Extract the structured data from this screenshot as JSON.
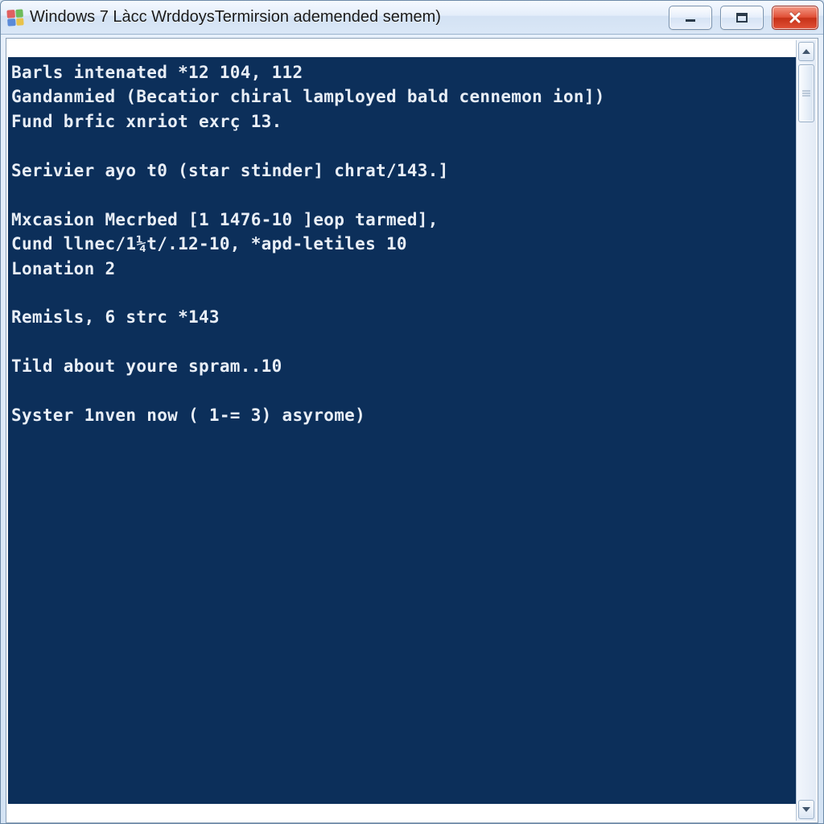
{
  "window": {
    "title": "Windows 7 Làcc WrddoysTermirsion ademended semem)"
  },
  "terminal": {
    "lines": [
      "Barls intenated *12 104, 112",
      "Gandanmied (Becatior chiral lamployed bald cennemon ion])",
      "Fund brfic xnriot exrç 13.",
      "",
      "Serivier ayo t0 (star stinder] chrat/143.]",
      "",
      "Mxcasion Mecrbed [1 1476-10 ]eop tarmed],",
      "Cund llnec/1¼t/.12-10, *apd-letiles 10",
      "Lonation 2",
      "",
      "Remisls, 6 strc *143",
      "",
      "Tild about youre spram..10",
      "",
      "Syster 1nven now ( 1-= 3) asyrome)"
    ]
  }
}
